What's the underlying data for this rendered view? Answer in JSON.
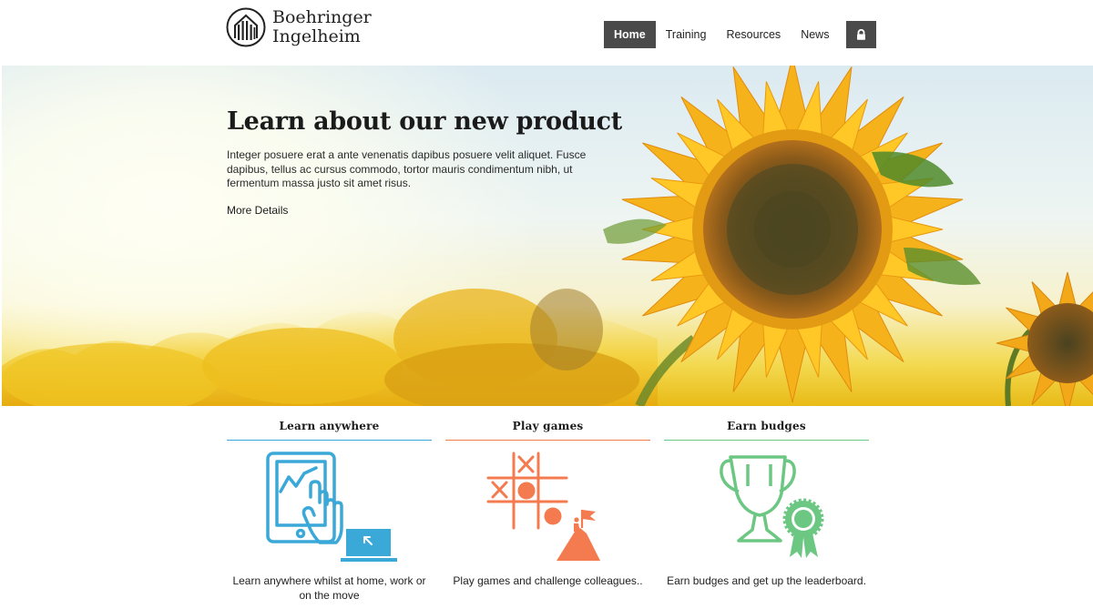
{
  "brand": {
    "name_line1": "Boehringer",
    "name_line2": "Ingelheim"
  },
  "nav": {
    "items": [
      {
        "label": "Home",
        "active": true
      },
      {
        "label": "Training",
        "active": false
      },
      {
        "label": "Resources",
        "active": false
      },
      {
        "label": "News",
        "active": false
      }
    ],
    "lock_icon": "lock-icon"
  },
  "hero": {
    "title": "Learn about our new product",
    "body": "Integer posuere erat a ante venenatis dapibus posuere velit aliquet. Fusce dapibus, tellus ac cursus commodo, tortor mauris condimentum nibh, ut fermentum massa justo sit amet risus.",
    "link": "More Details",
    "image": "sunflower-field-photo"
  },
  "features": [
    {
      "title": "Learn anywhere",
      "description": "Learn anywhere whilst at home, work or on the move",
      "color": "#3aa9d8",
      "icon": "tablet-laptop-icon"
    },
    {
      "title": "Play games",
      "description": "Play games and challenge colleagues..",
      "color": "#f47b4f",
      "icon": "tic-tac-toe-icon"
    },
    {
      "title": "Earn budges",
      "description": "Earn budges and get up the leaderboard.",
      "color": "#6cc783",
      "icon": "trophy-badge-icon"
    }
  ]
}
